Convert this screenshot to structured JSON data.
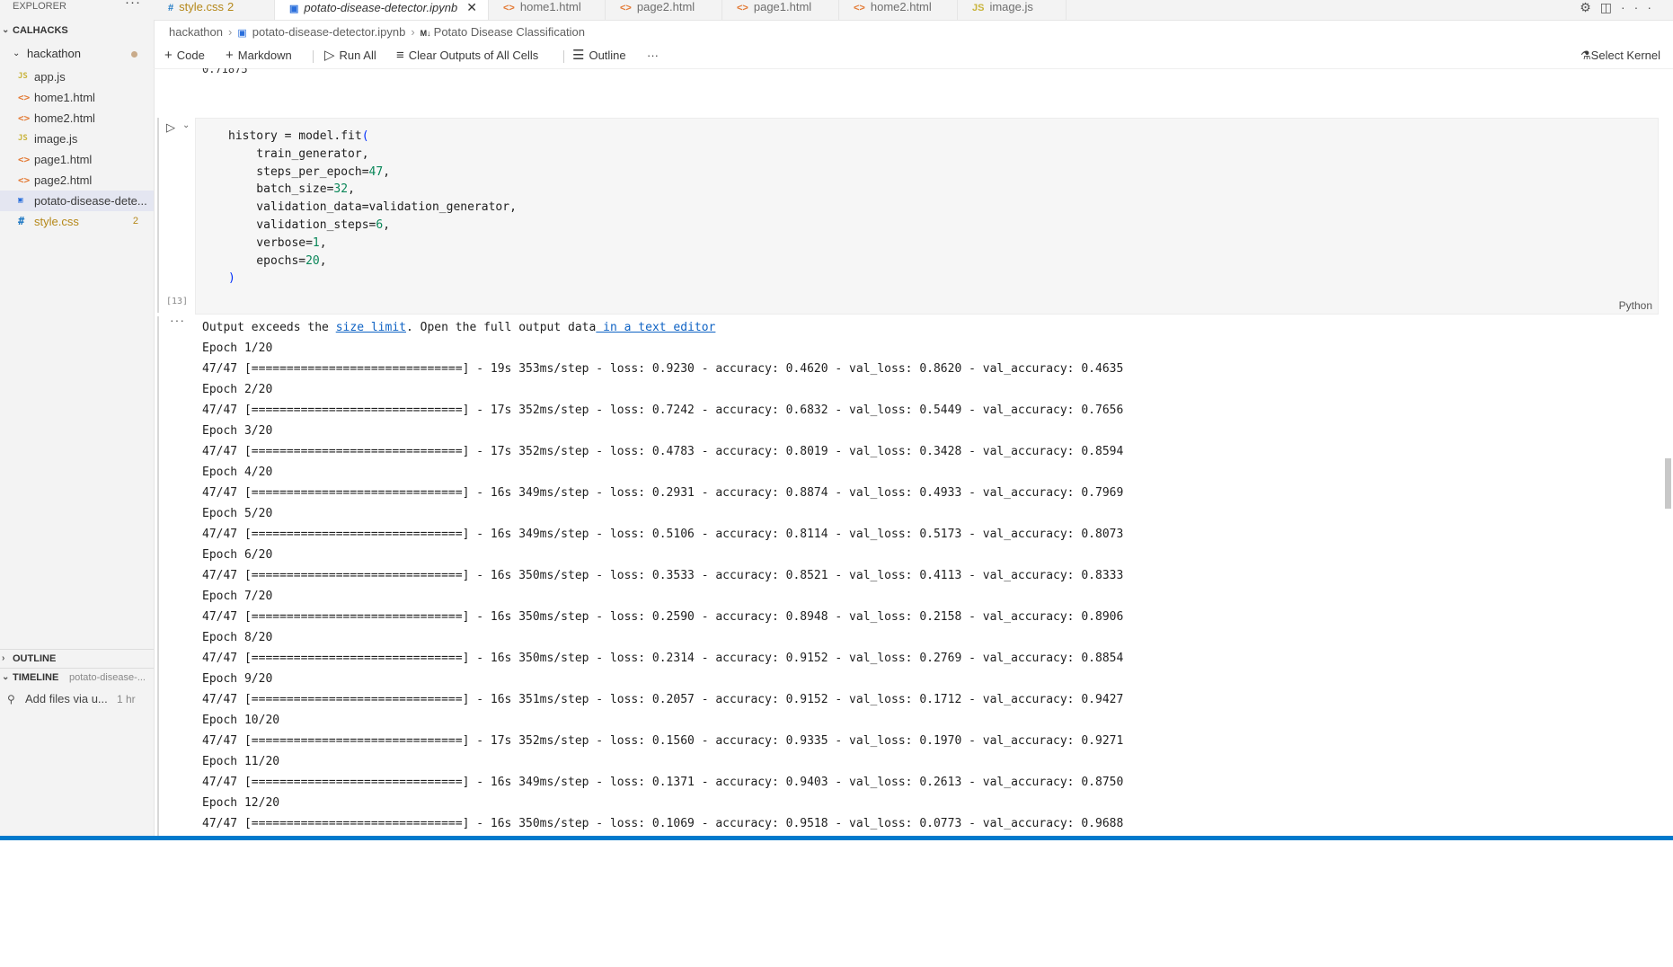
{
  "sidebar": {
    "title": "EXPLORER",
    "more": "···",
    "workspace": "CALHACKS",
    "folder": "hackathon",
    "files": [
      {
        "icon": "JS",
        "name": "app.js",
        "badge": ""
      },
      {
        "icon": "<>",
        "name": "home1.html",
        "badge": ""
      },
      {
        "icon": "<>",
        "name": "home2.html",
        "badge": ""
      },
      {
        "icon": "JS",
        "name": "image.js",
        "badge": ""
      },
      {
        "icon": "<>",
        "name": "page1.html",
        "badge": ""
      },
      {
        "icon": "<>",
        "name": "page2.html",
        "badge": ""
      },
      {
        "icon": "▣",
        "name": "potato-disease-dete...",
        "badge": ""
      },
      {
        "icon": "#",
        "name": "style.css",
        "badge": "2"
      }
    ],
    "outline": "OUTLINE",
    "timeline": "TIMELINE",
    "timeline_sub": "potato-disease-...",
    "timeline_item": {
      "label": "Add files via u...",
      "time": "1 hr"
    }
  },
  "tabs": [
    {
      "icon": "#",
      "label": "style.css",
      "badge": "2"
    },
    {
      "icon": "▣",
      "label": "potato-disease-detector.ipynb",
      "close": "✕"
    },
    {
      "icon": "<>",
      "label": "home1.html"
    },
    {
      "icon": "<>",
      "label": "page2.html"
    },
    {
      "icon": "<>",
      "label": "page1.html"
    },
    {
      "icon": "<>",
      "label": "home2.html"
    },
    {
      "icon": "JS",
      "label": "image.js"
    }
  ],
  "breadcrumb": {
    "folder": "hackathon",
    "file": "potato-disease-detector.ipynb",
    "md_icon": "M↓",
    "section": "Potato Disease Classification"
  },
  "toolbar": {
    "code": "Code",
    "markdown": "Markdown",
    "run_all": "Run All",
    "clear": "Clear Outputs of All Cells",
    "outline": "Outline",
    "more": "···",
    "kernel": "Select Kernel"
  },
  "editor": {
    "prev_output": "0.71875",
    "exec_count": "[13]",
    "language": "Python",
    "code": {
      "l1": "history = model.fit",
      "l2": "    train_generator,",
      "l3a": "    steps_per_epoch=",
      "l3n": "47",
      "l4a": "    batch_size=",
      "l4n": "32",
      "l5": "    validation_data=validation_generator,",
      "l6a": "    validation_steps=",
      "l6n": "6",
      "l7a": "    verbose=",
      "l7n": "1",
      "l8a": "    epochs=",
      "l8n": "20",
      "open": "(",
      "close": ")",
      "comma": ","
    },
    "output_notice": {
      "t1": "Output exceeds the ",
      "link1": "size limit",
      "t2": ". Open the full output data",
      "link2": " in a text editor"
    },
    "output_lines": [
      "Epoch 1/20",
      "47/47 [==============================] - 19s 353ms/step - loss: 0.9230 - accuracy: 0.4620 - val_loss: 0.8620 - val_accuracy: 0.4635",
      "Epoch 2/20",
      "47/47 [==============================] - 17s 352ms/step - loss: 0.7242 - accuracy: 0.6832 - val_loss: 0.5449 - val_accuracy: 0.7656",
      "Epoch 3/20",
      "47/47 [==============================] - 17s 352ms/step - loss: 0.4783 - accuracy: 0.8019 - val_loss: 0.3428 - val_accuracy: 0.8594",
      "Epoch 4/20",
      "47/47 [==============================] - 16s 349ms/step - loss: 0.2931 - accuracy: 0.8874 - val_loss: 0.4933 - val_accuracy: 0.7969",
      "Epoch 5/20",
      "47/47 [==============================] - 16s 349ms/step - loss: 0.5106 - accuracy: 0.8114 - val_loss: 0.5173 - val_accuracy: 0.8073",
      "Epoch 6/20",
      "47/47 [==============================] - 16s 350ms/step - loss: 0.3533 - accuracy: 0.8521 - val_loss: 0.4113 - val_accuracy: 0.8333",
      "Epoch 7/20",
      "47/47 [==============================] - 16s 350ms/step - loss: 0.2590 - accuracy: 0.8948 - val_loss: 0.2158 - val_accuracy: 0.8906",
      "Epoch 8/20",
      "47/47 [==============================] - 16s 350ms/step - loss: 0.2314 - accuracy: 0.9152 - val_loss: 0.2769 - val_accuracy: 0.8854",
      "Epoch 9/20",
      "47/47 [==============================] - 16s 351ms/step - loss: 0.2057 - accuracy: 0.9152 - val_loss: 0.1712 - val_accuracy: 0.9427",
      "Epoch 10/20",
      "47/47 [==============================] - 17s 352ms/step - loss: 0.1560 - accuracy: 0.9335 - val_loss: 0.1970 - val_accuracy: 0.9271",
      "Epoch 11/20",
      "47/47 [==============================] - 16s 349ms/step - loss: 0.1371 - accuracy: 0.9403 - val_loss: 0.2613 - val_accuracy: 0.8750",
      "Epoch 12/20",
      "47/47 [==============================] - 16s 350ms/step - loss: 0.1069 - accuracy: 0.9518 - val_loss: 0.0773 - val_accuracy: 0.9688"
    ]
  },
  "colors": {
    "accent": "#007acc",
    "link": "#0f63c4",
    "number": "#098658"
  }
}
